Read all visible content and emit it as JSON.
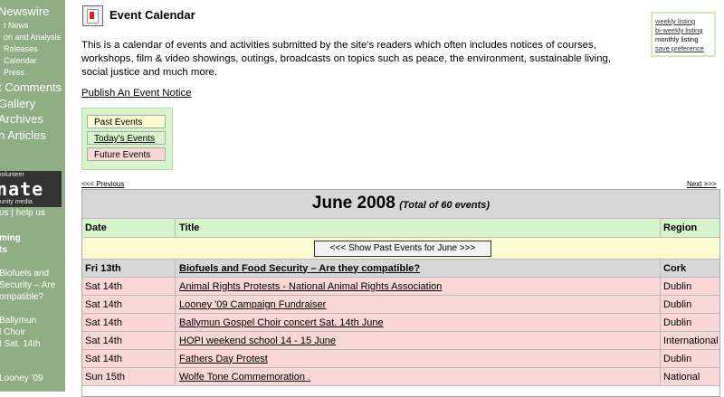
{
  "sidebar": {
    "items": [
      {
        "label": "Newswire"
      },
      {
        "label": "t News"
      },
      {
        "label": "on and Analysis"
      },
      {
        "label": "Releases"
      },
      {
        "label": "Calendar"
      },
      {
        "label": "Press"
      },
      {
        "label": "t Comments"
      },
      {
        "label": "Gallery"
      },
      {
        "label": "Archives"
      },
      {
        "label": "n Articles"
      }
    ],
    "donate_top": "volunteer",
    "donate_word": "nate",
    "donate_bottom": "unity media",
    "contact": "us | help us",
    "upcoming": "ming",
    "upcoming2": "ts",
    "upcoming_items": [
      "Biofuels and",
      "Security – Are",
      "ompatible?",
      "Ballymun",
      "l Choir",
      "t Sat. 14th",
      "Looney '09"
    ]
  },
  "header": {
    "title": "Event Calendar",
    "intro": "This is a calendar of events and activities submitted by the site's readers which often includes notices of courses, workshops, film & video showings, outings, broadcasts on topics such as peace, the environment, sustainable living, social justice and much more.",
    "publish_link": "Publish An Event Notice"
  },
  "view_options": {
    "weekly": "weekly listing",
    "biweekly": "bi-weekly listing",
    "monthly": "monthly listing",
    "save": "save preference"
  },
  "filters": {
    "past": "Past Events",
    "today": "Today's Events",
    "future": "Future Events"
  },
  "nav": {
    "prev": "<<< Previous",
    "next": "Next >>>"
  },
  "calendar": {
    "month": "June 2008",
    "total": "(Total of 60 events)",
    "columns": {
      "date": "Date",
      "title": "Title",
      "region": "Region"
    },
    "show_past": "<<<  Show Past Events for June  >>>",
    "events": [
      {
        "date": "Fri 13th",
        "title": "Biofuels and Food Security – Are they compatible?",
        "region": "Cork",
        "status": "today"
      },
      {
        "date": "Sat 14th",
        "title": "Animal Rights Protests - National Animal Rights Association",
        "region": "Dublin",
        "status": "future"
      },
      {
        "date": "Sat 14th",
        "title": "Looney '09 Campaign Fundraiser",
        "region": "Dublin",
        "status": "future"
      },
      {
        "date": "Sat 14th",
        "title": "Ballymun Gospel Choir concert Sat. 14th June",
        "region": "Dublin",
        "status": "future"
      },
      {
        "date": "Sat 14th",
        "title": "HOPI weekend school 14 - 15 June",
        "region": "International",
        "status": "future"
      },
      {
        "date": "Sat 14th",
        "title": "Fathers Day Protest",
        "region": "Dublin",
        "status": "future"
      },
      {
        "date": "Sun 15th",
        "title": "Wolfe Tone Commemoration .",
        "region": "National",
        "status": "future"
      }
    ]
  },
  "colors": {
    "sidebar_bg": "#8fae85",
    "today_bg": "#d7d7d7",
    "future_bg": "#f9d7d7",
    "past_bg": "#fbfbd2",
    "header_bg": "#d7f3cc"
  }
}
